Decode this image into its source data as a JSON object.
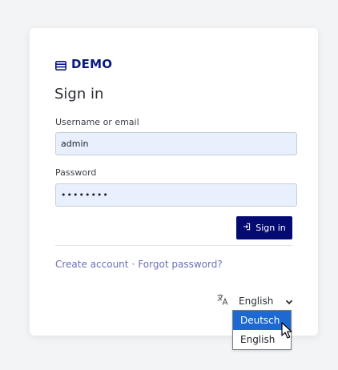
{
  "brand": {
    "name": "DEMO",
    "icon": "server-icon",
    "color": "#0b1a7d"
  },
  "form": {
    "title": "Sign in",
    "username_label": "Username or email",
    "username_value": "admin",
    "password_label": "Password",
    "password_value": "••••••••",
    "submit_label": "Sign in",
    "submit_icon": "sign-in-icon",
    "accent": "#050a73"
  },
  "links": {
    "create_account": "Create account",
    "separator": "·",
    "forgot_password": "Forgot password?",
    "color": "#6b6fb8"
  },
  "language": {
    "icon": "translate-icon",
    "selected": "English",
    "options": [
      "Deutsch",
      "English"
    ],
    "highlighted": "Deutsch",
    "highlight_color": "#1e68d1"
  },
  "pointer": {
    "icon": "mouse-pointer-icon"
  }
}
